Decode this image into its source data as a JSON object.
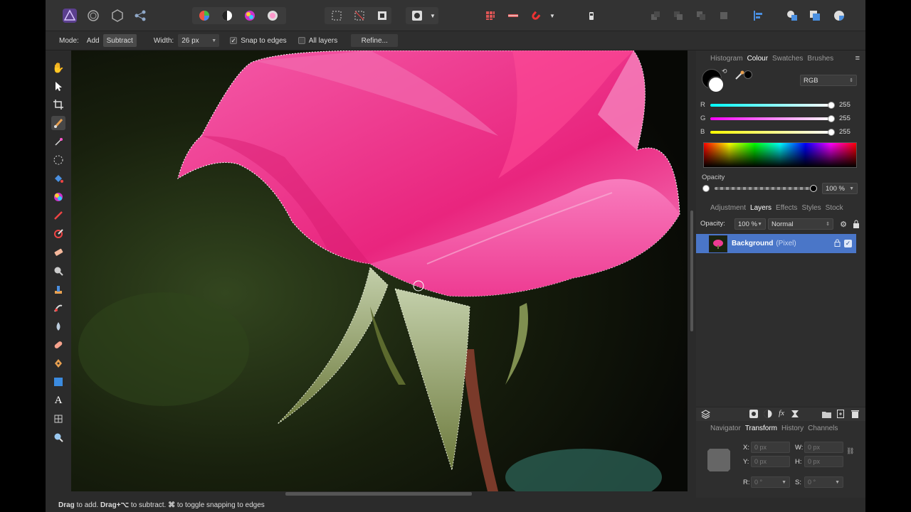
{
  "context_bar": {
    "mode_label": "Mode:",
    "add_label": "Add",
    "subtract_label": "Subtract",
    "width_label": "Width:",
    "width_value": "26 px",
    "snap_label": "Snap to edges",
    "snap_checked": true,
    "all_layers_label": "All layers",
    "refine_label": "Refine..."
  },
  "colour_panel": {
    "tabs": [
      "Histogram",
      "Colour",
      "Swatches",
      "Brushes"
    ],
    "active_tab": "Colour",
    "model": "RGB",
    "channels": [
      {
        "label": "R",
        "value": "255"
      },
      {
        "label": "G",
        "value": "255"
      },
      {
        "label": "B",
        "value": "255"
      }
    ],
    "opacity_label": "Opacity",
    "opacity_value": "100 %"
  },
  "layers_panel": {
    "tabs": [
      "Adjustment",
      "Layers",
      "Effects",
      "Styles",
      "Stock"
    ],
    "active_tab": "Layers",
    "opacity_label": "Opacity:",
    "opacity_value": "100 %",
    "blend_mode": "Normal",
    "layer": {
      "name": "Background",
      "type": "(Pixel)"
    }
  },
  "transform_panel": {
    "tabs": [
      "Navigator",
      "Transform",
      "History",
      "Channels"
    ],
    "active_tab": "Transform",
    "fields": {
      "x_label": "X:",
      "x_value": "0 px",
      "y_label": "Y:",
      "y_value": "0 px",
      "w_label": "W:",
      "w_value": "0 px",
      "h_label": "H:",
      "h_value": "0 px",
      "r_label": "R:",
      "r_value": "0 °",
      "s_label": "S:",
      "s_value": "0 °"
    }
  },
  "status_bar": {
    "text_bold1": "Drag",
    "text1": " to add. ",
    "text_bold2": "Drag+⌥",
    "text2": " to subtract. ",
    "text_bold3": "⌘",
    "text3": " to toggle snapping to edges"
  },
  "colors": {
    "accent": "#4a76c8",
    "canvas_bg": "#141a0c",
    "rose_pink": "#ee2f8a"
  }
}
